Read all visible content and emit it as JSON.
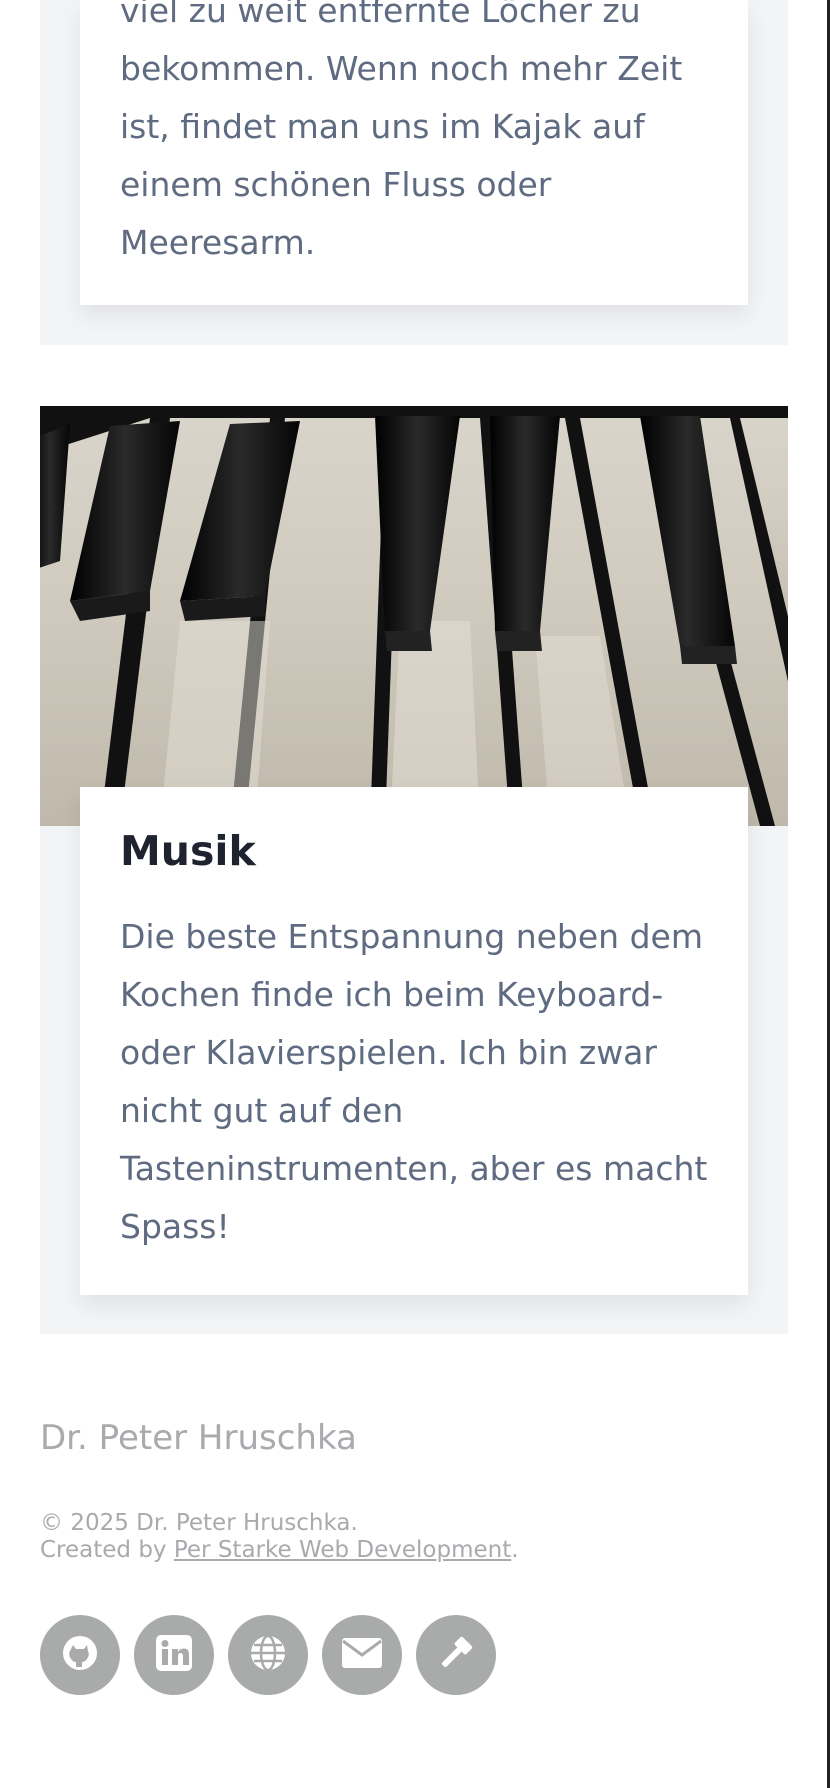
{
  "cards": {
    "upper": {
      "text_lines": [
        "viel zu weit entfernte Löcher zu",
        "bekommen. Wenn noch mehr Zeit",
        "ist, findet man uns im Kajak auf",
        "einem schönen Fluss oder",
        "Meeresarm."
      ]
    },
    "music": {
      "title": "Musik",
      "text_lines": [
        "Die beste Entspannung neben dem",
        "Kochen finde ich beim Keyboard-",
        "oder Klavierspielen. Ich bin zwar",
        "nicht gut auf den",
        "Tasteninstrumenten, aber es macht",
        "Spass!"
      ]
    }
  },
  "footer": {
    "name": "Dr. Peter Hruschka",
    "copyright": "© 2025 Dr. Peter Hruschka.",
    "created_by_prefix": "Created by ",
    "created_by_link": "Per Starke Web Development",
    "created_by_suffix": "."
  },
  "social_icons": [
    "github-icon",
    "linkedin-icon",
    "globe-icon",
    "envelope-icon",
    "gavel-icon"
  ],
  "colors": {
    "card_background": "#f3f4f6",
    "body_text": "#5f6b80",
    "title_text": "#1f2330",
    "footer_text": "#a8aaad",
    "social_circle": "#a8aba9"
  }
}
